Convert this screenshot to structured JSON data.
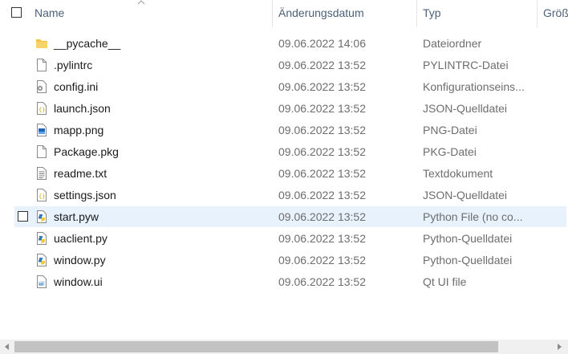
{
  "columns": {
    "name": "Name",
    "date": "Änderungsdatum",
    "type": "Typ",
    "size": "Größ"
  },
  "files": [
    {
      "name": "__pycache__",
      "date": "09.06.2022 14:06",
      "type": "Dateiordner",
      "icon": "folder-icon"
    },
    {
      "name": ".pylintrc",
      "date": "09.06.2022 13:52",
      "type": "PYLINTRC-Datei",
      "icon": "blank-file-icon"
    },
    {
      "name": "config.ini",
      "date": "09.06.2022 13:52",
      "type": "Konfigurationseins...",
      "icon": "settings-file-icon"
    },
    {
      "name": "launch.json",
      "date": "09.06.2022 13:52",
      "type": "JSON-Quelldatei",
      "icon": "json-file-icon"
    },
    {
      "name": "mapp.png",
      "date": "09.06.2022 13:52",
      "type": "PNG-Datei",
      "icon": "image-file-icon"
    },
    {
      "name": "Package.pkg",
      "date": "09.06.2022 13:52",
      "type": "PKG-Datei",
      "icon": "blank-file-icon"
    },
    {
      "name": "readme.txt",
      "date": "09.06.2022 13:52",
      "type": "Textdokument",
      "icon": "text-file-icon"
    },
    {
      "name": "settings.json",
      "date": "09.06.2022 13:52",
      "type": "JSON-Quelldatei",
      "icon": "json-file-icon"
    },
    {
      "name": "start.pyw",
      "date": "09.06.2022 13:52",
      "type": "Python File (no co...",
      "icon": "python-file-icon",
      "selected": true
    },
    {
      "name": "uaclient.py",
      "date": "09.06.2022 13:52",
      "type": "Python-Quelldatei",
      "icon": "python-file-icon"
    },
    {
      "name": "window.py",
      "date": "09.06.2022 13:52",
      "type": "Python-Quelldatei",
      "icon": "python-file-icon"
    },
    {
      "name": "window.ui",
      "date": "09.06.2022 13:52",
      "type": "Qt UI file",
      "icon": "ui-file-icon"
    }
  ],
  "colors": {
    "selection": "#e8f2fc",
    "header_text": "#4c607a",
    "folder": "#f5c243",
    "python_blue": "#3b78b4",
    "python_yellow": "#f0c93a"
  }
}
